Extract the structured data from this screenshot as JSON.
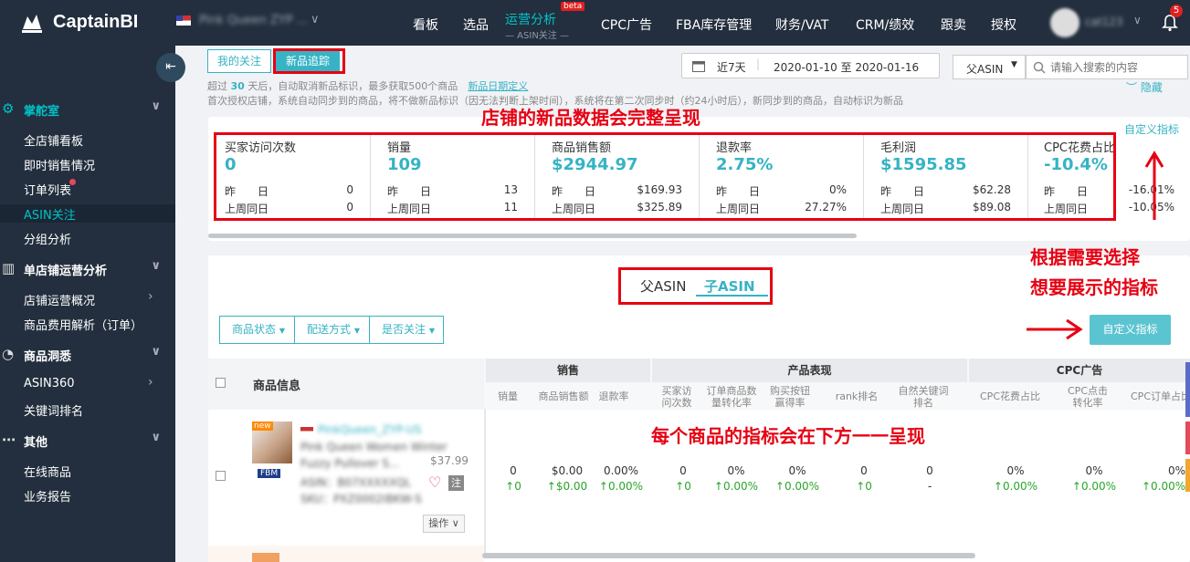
{
  "header": {
    "logo_text": "CaptainBI",
    "store_name": "Pink Queen ZYP ...",
    "nav": [
      "看板",
      "选品",
      "CPC广告",
      "FBA库存管理",
      "财务/VAT",
      "CRM/绩效",
      "跟卖",
      "授权"
    ],
    "active_nav": "运营分析",
    "active_sub": "— ASIN关注 —",
    "beta": "beta",
    "username": "cat123",
    "notification_count": "5"
  },
  "sidebar": {
    "sections": [
      {
        "icon": "gear-icon",
        "label": "掌舵室",
        "items": [
          "全店铺看板",
          "即时销售情况",
          "订单列表",
          "ASIN关注",
          "分组分析"
        ]
      },
      {
        "icon": "bar-chart-icon",
        "label": "单店铺运营分析",
        "items": [
          "店铺运营概况",
          "商品费用解析（订单）"
        ]
      },
      {
        "icon": "pie-chart-icon",
        "label": "商品洞悉",
        "items": [
          "ASIN360",
          "关键词排名"
        ]
      },
      {
        "icon": "more-icon",
        "label": "其他",
        "items": [
          "在线商品",
          "业务报告"
        ]
      }
    ],
    "active_item": "ASIN关注",
    "accent": "#00c2c9"
  },
  "tabs": [
    "我的关注",
    "新品追踪"
  ],
  "info": {
    "line1_pre": "超过",
    "line1_days": "30",
    "line1_post": "天后，自动取消新品标识，最多获取500个商品",
    "line1_link": "新品日期定义",
    "line2": "首次授权店铺，系统自动同步到的商品，将不做新品标识（因无法判断上架时间），系统将在第二次同步时（约24小时后），新同步到的商品，自动标识为新品"
  },
  "date": {
    "preset": "近7天",
    "range": "2020-01-10 至 2020-01-16"
  },
  "asin_select": "父ASIN",
  "search_placeholder": "请输入搜索的内容",
  "hide_label": "隐藏",
  "custom_metric_link": "自定义指标",
  "metrics": [
    {
      "title": "买家访问次数",
      "value": "0",
      "yesterday": "0",
      "last_week": "0"
    },
    {
      "title": "销量",
      "value": "109",
      "yesterday": "13",
      "last_week": "11"
    },
    {
      "title": "商品销售额",
      "value": "$2944.97",
      "yesterday": "$169.93",
      "last_week": "$325.89"
    },
    {
      "title": "退款率",
      "value": "2.75%",
      "yesterday": "0%",
      "last_week": "27.27%"
    },
    {
      "title": "毛利润",
      "value": "$1595.85",
      "yesterday": "$62.28",
      "last_week": "$89.08"
    },
    {
      "title": "CPC花费占比",
      "value": "-10.4%",
      "yesterday": "-16.01%",
      "last_week": "-10.05%"
    }
  ],
  "metric_labels": {
    "yesterday": "昨　　日",
    "last_week": "上周同日"
  },
  "annotations": {
    "a1": "店铺的新品数据会完整呈现",
    "a2": "根据需要选择",
    "a3": "想要展示的指标",
    "a4": "每个商品的指标会在下方一一呈现"
  },
  "asin_toggle": {
    "parent": "父ASIN",
    "child": "子ASIN"
  },
  "filters": [
    "商品状态",
    "配送方式",
    "是否关注"
  ],
  "custom_btn": "自定义指标",
  "table": {
    "product_header": "商品信息",
    "groups": [
      "销售",
      "产品表现",
      "CPC广告"
    ],
    "sub_headers": [
      "销量",
      "商品销售额",
      "退款率",
      "买家访问次数",
      "订单商品数量转化率",
      "购买按钮赢得率",
      "rank排名",
      "自然关键词排名",
      "CPC花费占比",
      "CPC点击转化率",
      "CPC订单占比"
    ],
    "row": {
      "new_badge": "new",
      "fbm": "FBM",
      "store": "PinkQueen_ZYP-US",
      "title_l1": "Pink Queen Women Winter",
      "title_l2": "Fuzzy Pullover S...",
      "asin": "ASIN：B07XXXXXQL",
      "sku": "SKU：PXZ0002IBKW-S",
      "price": "$37.99",
      "note": "注",
      "op": "操作 ∨",
      "values": [
        "0",
        "$0.00",
        "0.00%",
        "0",
        "0%",
        "0%",
        "0",
        "0",
        "0%",
        "0%",
        "0%"
      ],
      "changes": [
        "↑0",
        "↑$0.00",
        "↑0.00%",
        "↑0",
        "↑0.00%",
        "↑0.00%",
        "↑0",
        "-",
        "↑0.00%",
        "↑0.00%",
        "↑0.00%"
      ]
    }
  }
}
